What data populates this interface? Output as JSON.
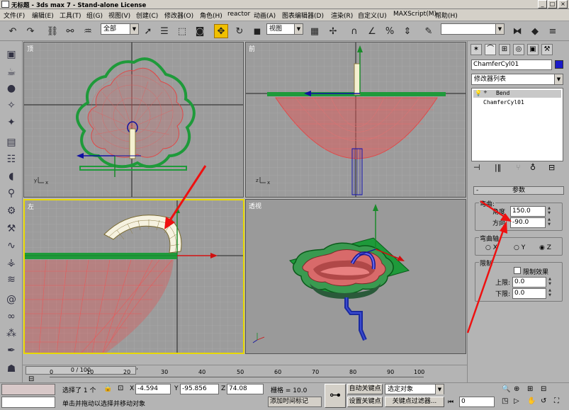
{
  "window": {
    "title": "无标题 - 3ds max 7 - Stand-alone License",
    "min_label": "_",
    "max_label": "□",
    "close_label": "×"
  },
  "menu": [
    "文件(F)",
    "编辑(E)",
    "工具(T)",
    "组(G)",
    "视图(V)",
    "创建(C)",
    "修改器(O)",
    "角色(H)",
    "reactor",
    "动画(A)",
    "图表编辑器(D)",
    "渲染(R)",
    "自定义(U)",
    "MAXScript(M)",
    "帮助(H)"
  ],
  "toolbar": {
    "selection_filter": "全部",
    "coord_system": "视图",
    "named_selection": ""
  },
  "viewports": {
    "top": {
      "label": "顶"
    },
    "front": {
      "label": "前"
    },
    "left": {
      "label": "左"
    },
    "perspective": {
      "label": "透视"
    }
  },
  "command_panel": {
    "object_name": "ChamferCyl01",
    "object_color": "#1a1ac8",
    "modifier_list": "修改器列表",
    "stack": [
      "Bend",
      "ChamferCyl01"
    ],
    "rollout_title": "参数",
    "toggle_minus": "-",
    "bend": {
      "group_label": "弯曲:",
      "angle_label": "角度",
      "angle_value": "150.0",
      "direction_label": "方向",
      "direction_value": "-90.0"
    },
    "axis": {
      "group_label": "弯曲轴:",
      "options": [
        "X",
        "Y",
        "Z"
      ],
      "selected": "Z"
    },
    "limits": {
      "group_label": "限制",
      "limit_effect_label": "限制效果",
      "upper_label": "上限:",
      "upper_value": "0.0",
      "lower_label": "下限:",
      "lower_value": "0.0"
    }
  },
  "timeline": {
    "frame_display": "0 / 100",
    "ticks": [
      "0",
      "10",
      "20",
      "30",
      "40",
      "50",
      "60",
      "70",
      "80",
      "90",
      "100"
    ]
  },
  "status": {
    "selected_label": "选择了 1 个",
    "x_label": "X",
    "x_value": "-4.594",
    "y_label": "Y",
    "y_value": "-95.856",
    "z_label": "Z",
    "z_value": "74.08",
    "grid_label": "栅格 = 10.0",
    "hint": "单击并拖动以选择并移动对象",
    "add_time_tag": "添加时间标记",
    "auto_key": "自动关键点",
    "set_key": "设置关键点",
    "selected_objects": "选定对象",
    "key_filters": "关键点过滤器...",
    "frame_value": "0"
  }
}
